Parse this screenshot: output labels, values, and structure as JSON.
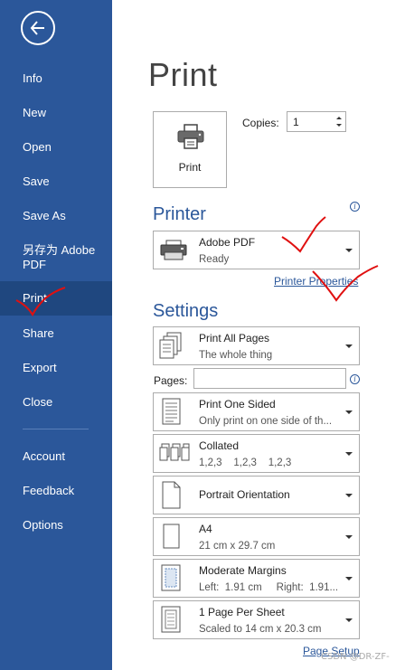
{
  "sidebar": {
    "items": [
      {
        "label": "Info"
      },
      {
        "label": "New"
      },
      {
        "label": "Open"
      },
      {
        "label": "Save"
      },
      {
        "label": "Save As"
      },
      {
        "label": "另存为 Adobe PDF"
      },
      {
        "label": "Print",
        "selected": true
      },
      {
        "label": "Share"
      },
      {
        "label": "Export"
      },
      {
        "label": "Close"
      },
      {
        "label": "Account"
      },
      {
        "label": "Feedback"
      },
      {
        "label": "Options"
      }
    ],
    "back_icon": "back-arrow-icon",
    "background": "#2b579a",
    "selected_background": "#1f477f"
  },
  "main": {
    "title": "Print",
    "print_button": {
      "label": "Print",
      "icon": "printer-icon"
    },
    "copies": {
      "label": "Copies:",
      "value": "1"
    },
    "printer": {
      "section_title": "Printer",
      "name": "Adobe PDF",
      "status": "Ready",
      "properties_link": "Printer Properties"
    },
    "settings": {
      "section_title": "Settings",
      "pages_label": "Pages:",
      "pages_value": "",
      "options": [
        {
          "title": "Print All Pages",
          "subtitle": "The whole thing",
          "icon": "pages-icon"
        },
        {
          "title": "Print One Sided",
          "subtitle": "Only print on one side of th...",
          "icon": "one-sided-icon"
        },
        {
          "title": "Collated",
          "subtitle": "1,2,3    1,2,3    1,2,3",
          "icon": "collated-icon"
        },
        {
          "title": "Portrait Orientation",
          "subtitle": "",
          "icon": "portrait-icon"
        },
        {
          "title": "A4",
          "subtitle": "21 cm x 29.7 cm",
          "icon": "paper-size-icon"
        },
        {
          "title": "Moderate Margins",
          "subtitle": "Left:  1.91 cm     Right:  1.91...",
          "icon": "margins-icon"
        },
        {
          "title": "1 Page Per Sheet",
          "subtitle": "Scaled to 14 cm x 20.3 cm",
          "icon": "pages-per-sheet-icon"
        }
      ],
      "page_setup_link": "Page Setup"
    },
    "accent": "#2b579a"
  },
  "watermark": "CSDN @DR-ZF-"
}
